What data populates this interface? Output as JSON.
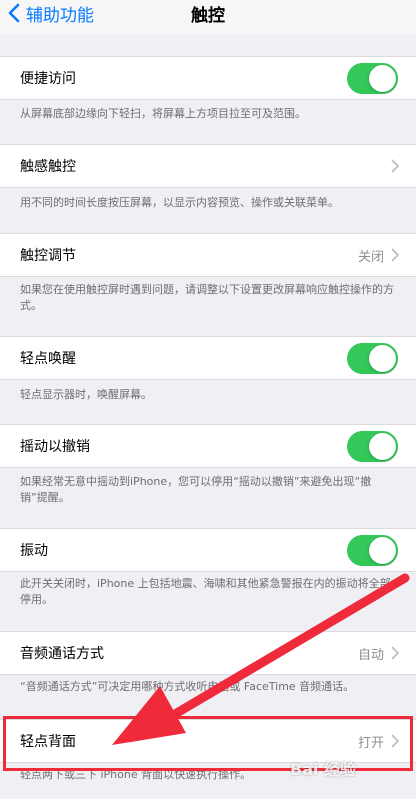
{
  "nav": {
    "back_label": "辅助功能",
    "title": "触控"
  },
  "sections": [
    {
      "label": "便捷访问",
      "footer": "从屏幕底部边缘向下轻扫，将屏幕上方项目拉至可及范围。"
    },
    {
      "label": "触感触控",
      "footer": "用不同的时间长度按压屏幕，以显示内容预览、操作或关联菜单。"
    },
    {
      "label": "触控调节",
      "value": "关闭",
      "footer": "如果您在使用触控屏时遇到问题，请调整以下设置更改屏幕响应触控操作的方式。"
    },
    {
      "label": "轻点唤醒",
      "footer": "轻点显示器时，唤醒屏幕。"
    },
    {
      "label": "摇动以撤销",
      "footer": "如果经常无意中摇动到iPhone，您可以停用“摇动以撤销”来避免出现“撤销”提醒。"
    },
    {
      "label": "振动",
      "footer": "此开关关闭时，iPhone 上包括地震、海啸和其他紧急警报在内的振动将全部停用。"
    },
    {
      "label": "音频通话方式",
      "value": "自动",
      "footer": "“音频通话方式”可决定用哪种方式收听电话或 FaceTime 音频通话。"
    },
    {
      "label": "轻点背面",
      "value": "打开",
      "footer": "轻点两下或三下 iPhone 背面以快速执行操作。"
    }
  ],
  "toggles": {
    "便捷访问": true,
    "轻点唤醒": true,
    "摇动以撤销": true,
    "振动": true
  },
  "colors": {
    "accent": "#0a7aff",
    "toggle_on": "#34c759",
    "annotation": "#ef2a3a"
  },
  "watermark": "Bai 经验"
}
